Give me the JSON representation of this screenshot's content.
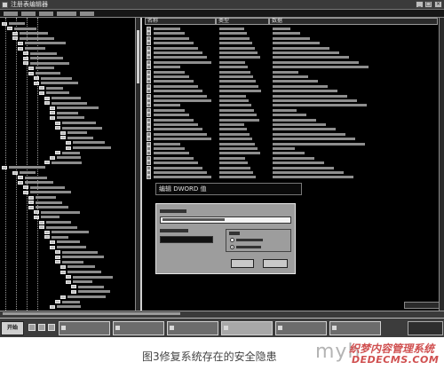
{
  "window": {
    "title": "注册表编辑器"
  },
  "values_pane": {
    "columns": [
      "名称",
      "类型",
      "数据"
    ]
  },
  "dialog": {
    "header_text": "编辑 DWORD 值"
  },
  "taskbar": {
    "start_label": "开始"
  },
  "caption": "图3修复系统存在的安全隐患",
  "watermark": {
    "latin": "myh",
    "cn": "织梦内容管理系统",
    "url": "DEDECMS.COM"
  }
}
